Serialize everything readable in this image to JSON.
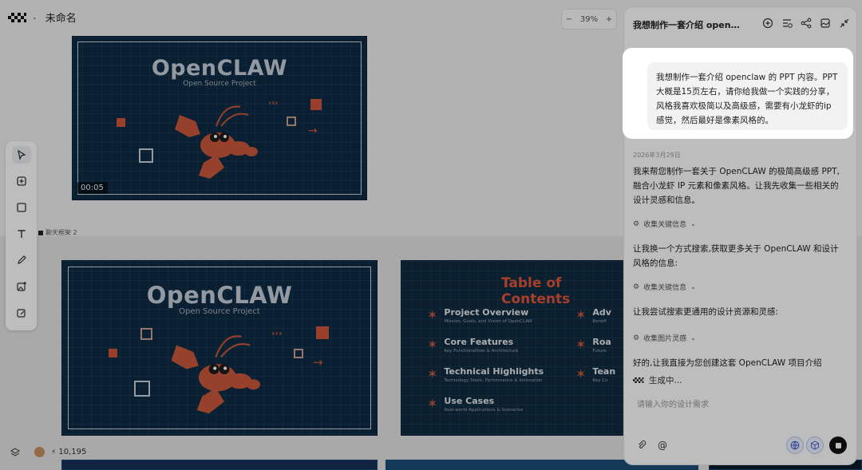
{
  "header": {
    "title": "未命名"
  },
  "zoom": {
    "minus": "−",
    "value": "39%",
    "plus": "+"
  },
  "slides": {
    "s1": {
      "title": "OpenCLAW",
      "subtitle": "Open Source Project",
      "time": "00:05"
    },
    "frame_label": "聊天框架 2",
    "s2": {
      "title": "OpenCLAW",
      "subtitle": "Open Source Project"
    },
    "toc": {
      "title": "Table of Contents",
      "items": [
        {
          "title": "Project Overview",
          "desc": "Mission, Goals, and Vision of OpenCLAW"
        },
        {
          "title": "Core Features",
          "desc": "Key Functionalities & Architecture"
        },
        {
          "title": "Technical Highlights",
          "desc": "Technology Stack, Performance & Innovation"
        },
        {
          "title": "Use Cases",
          "desc": "Real-world Applications & Scenarios"
        }
      ],
      "right_items": [
        {
          "title": "Adv",
          "desc": "Benefi"
        },
        {
          "title": "Roa",
          "desc": "Future"
        },
        {
          "title": "Tean",
          "desc": "Key Co"
        }
      ]
    }
  },
  "footer": {
    "credits": "10,195"
  },
  "chat": {
    "title": "我想制作一套介绍 opencla...",
    "user_message": "我想制作一套介绍 openclaw 的 PPT 内容。PPT 大概是15页左右，请你给我做一个实践的分享，风格我喜欢极简以及高级感，需要有小龙虾的ip感觉，然后最好是像素风格的。",
    "date": "2026年3月29日",
    "reply1": "我来帮您制作一套关于 OpenCLAW 的极简高级感 PPT,融合小龙虾 IP 元素和像素风格。让我先收集一些相关的设计灵感和信息。",
    "tool1": "收集关键信息",
    "reply2": "让我换一个方式搜索,获取更多关于 OpenCLAW 和设计风格的信息:",
    "tool2": "收集关键信息",
    "reply3": "让我尝试搜索更通用的设计资源和灵感:",
    "tool3": "收集图片灵感",
    "reply4": "好的,让我直接为您创建这套 OpenCLAW 项目介绍",
    "generating": "生成中...",
    "input_placeholder": "请输入你的设计需求"
  },
  "colors": {
    "slide_bg": "#0f2a44",
    "accent": "#e2553a",
    "title_gray": "#c6cfd8"
  }
}
